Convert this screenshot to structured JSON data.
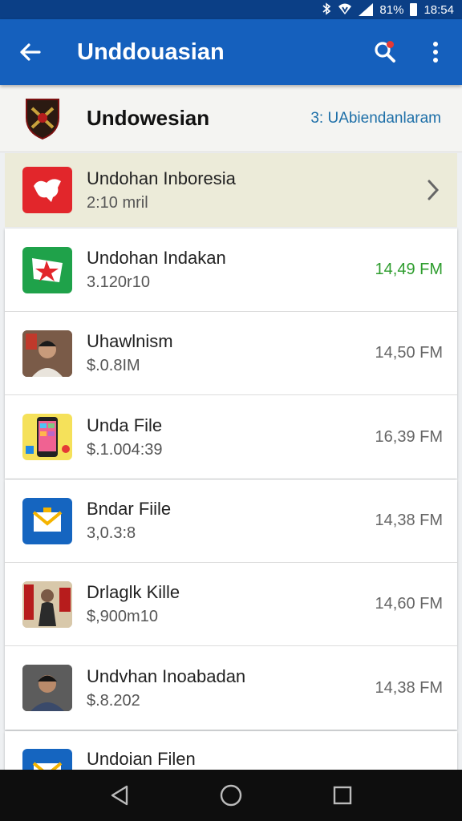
{
  "status_bar": {
    "battery_percent": "81%",
    "time": "18:54",
    "bluetooth_icon": "bluetooth-icon",
    "wifi_icon": "wifi-icon",
    "signal_icon": "signal-icon",
    "battery_icon": "battery-icon"
  },
  "app_bar": {
    "title": "Unddouasian",
    "back_icon": "arrow-left-icon",
    "search_icon": "search-icon",
    "more_icon": "more-vert-icon",
    "color": "#1560bd"
  },
  "header": {
    "title": "Undowesian",
    "link": "3: UAbiendanlaram",
    "icon": "crest-icon"
  },
  "featured": {
    "name": "Undohan Inboresia",
    "sub": "2:10 mril",
    "icon": "red-app-icon"
  },
  "list": [
    {
      "name": "Undohan Indakan",
      "sub": "3.120r10",
      "time": "14,49 FM",
      "icon": "green-star-app-icon",
      "time_color": "#2e9d2e"
    },
    {
      "name": "Uhawlnism",
      "sub": "$.0.8IM",
      "time": "14,50 FM",
      "icon": "person-photo-icon"
    },
    {
      "name": "Unda File",
      "sub": "$.1.004:39",
      "time": "16,39 FM",
      "icon": "phone-app-icon"
    },
    {
      "name": "Bndar Fiile",
      "sub": "3,0.3:8",
      "time": "14,38 FM",
      "icon": "mail-app-icon"
    },
    {
      "name": "Drlaglk Kille",
      "sub": "$,900m10",
      "time": "14,60 FM",
      "icon": "person-photo-icon"
    },
    {
      "name": "Undvhan Inoabadan",
      "sub": "$.8.202",
      "time": "14,38 FM",
      "icon": "person-photo-icon"
    },
    {
      "name": "Undoian Filen",
      "sub": "",
      "time": "",
      "icon": "mail-app-icon"
    }
  ],
  "nav": {
    "back_icon": "nav-back-icon",
    "home_icon": "nav-home-icon",
    "recents_icon": "nav-recents-icon"
  }
}
